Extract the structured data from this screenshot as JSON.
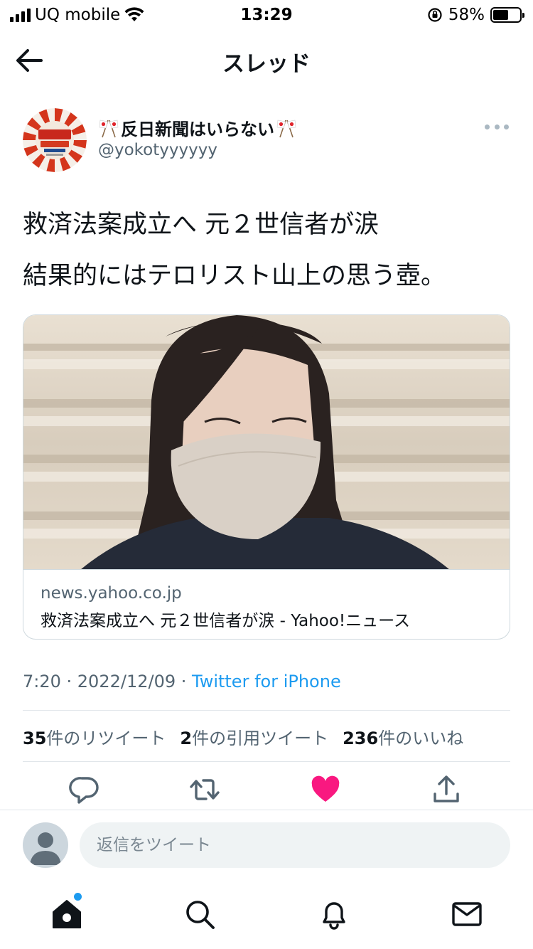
{
  "status_bar": {
    "carrier": "UQ mobile",
    "time": "13:29",
    "battery_percent_label": "58%",
    "battery_level": 0.58
  },
  "header": {
    "title": "スレッド",
    "back_icon": "arrow-left-icon"
  },
  "tweet": {
    "author_name": "反日新聞はいらない",
    "author_handle": "@yokotyyyyyy",
    "text_lines": [
      "救済法案成立へ 元２世信者が涙",
      "結果的にはテロリスト山上の思う壺。"
    ],
    "card": {
      "domain": "news.yahoo.co.jp",
      "title": "救済法案成立へ 元２世信者が涙 - Yahoo!ニュース"
    },
    "timestamp": "7:20 · 2022/12/09 · ",
    "source": "Twitter for iPhone",
    "stats": {
      "retweets_count": "35",
      "retweets_label": "件のリツイート",
      "quotes_count": "2",
      "quotes_label": "件の引用ツイート",
      "likes_count": "236",
      "likes_label": "件のいいね"
    }
  },
  "reply": {
    "placeholder": "返信をツイート"
  },
  "icons": {
    "reply": "comment-icon",
    "retweet": "retweet-icon",
    "like": "heart-icon",
    "share": "share-icon",
    "home": "home-icon",
    "search": "search-icon",
    "notifications": "bell-icon",
    "messages": "mail-icon"
  },
  "colors": {
    "accent": "#1d9bf0",
    "like": "#f91880",
    "text": "#0f1419",
    "muted": "#536471"
  }
}
